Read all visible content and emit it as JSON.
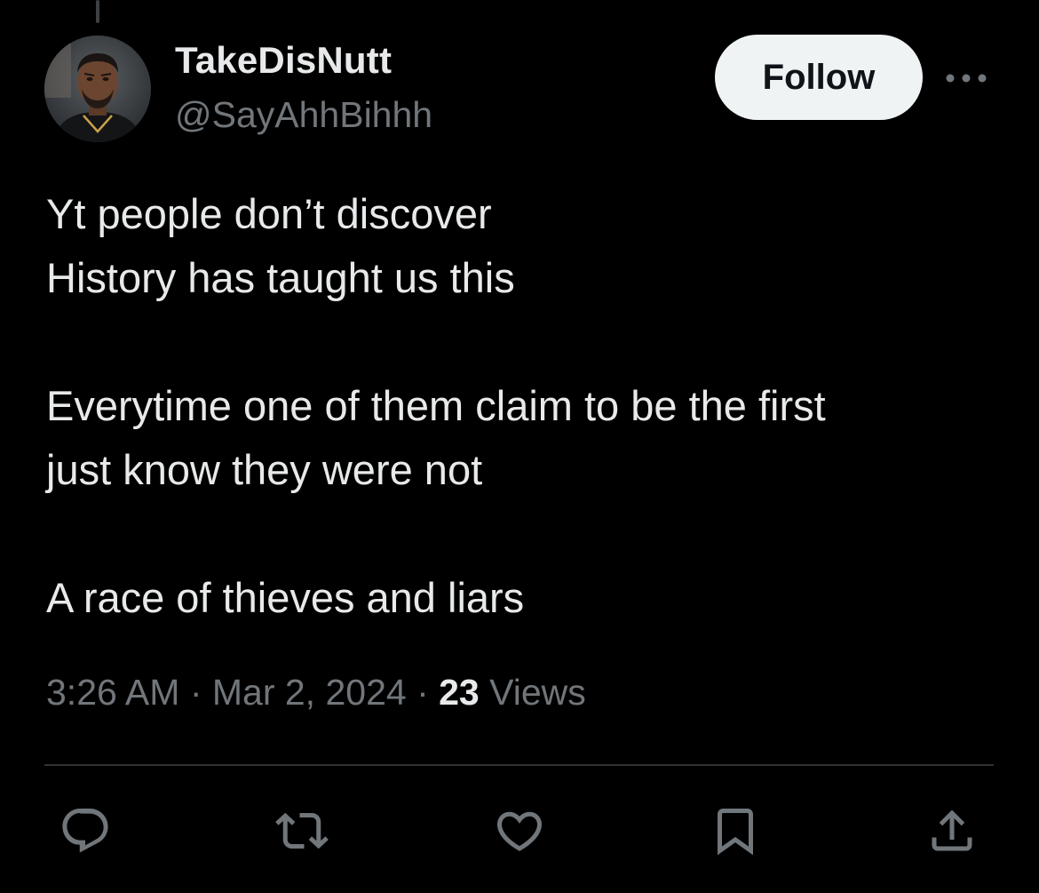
{
  "author": {
    "display_name": "TakeDisNutt",
    "handle": "@SayAhhBihhh",
    "avatar_icon": "avatar-photo"
  },
  "follow_button": {
    "label": "Follow"
  },
  "more_button": {
    "icon": "more-horizontal-icon"
  },
  "tweet": {
    "lines": [
      "Yt people don’t discover",
      "History has taught us this",
      "",
      "Everytime one of them claim to be the first",
      "just know they were not",
      "",
      "A race of thieves and liars"
    ]
  },
  "meta": {
    "time": "3:26 AM",
    "separator": " · ",
    "date": "Mar 2, 2024",
    "views_count": "23",
    "views_label": "Views"
  },
  "actions": [
    {
      "name": "reply",
      "icon": "reply-icon"
    },
    {
      "name": "retweet",
      "icon": "retweet-icon"
    },
    {
      "name": "like",
      "icon": "heart-icon"
    },
    {
      "name": "bookmark",
      "icon": "bookmark-icon"
    },
    {
      "name": "share",
      "icon": "share-icon"
    }
  ],
  "colors": {
    "background": "#000000",
    "primary_text": "#e7e9ea",
    "secondary_text": "#71767b",
    "follow_bg": "#eff3f4",
    "divider": "#2f3336"
  }
}
